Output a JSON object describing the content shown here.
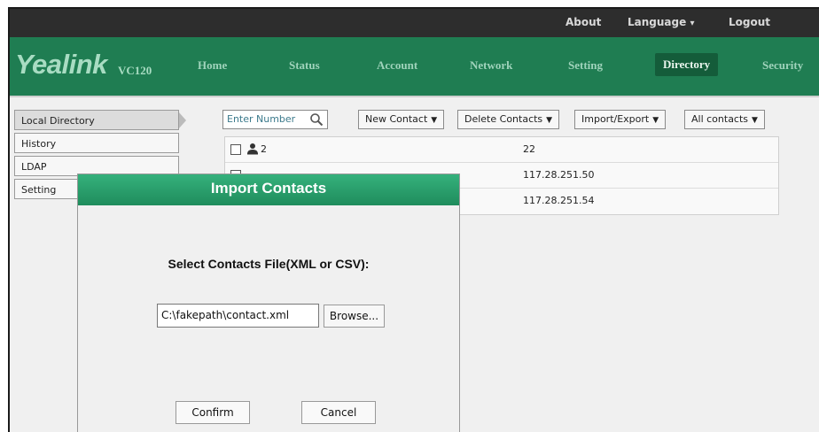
{
  "topbar": {
    "about": "About",
    "language": "Language",
    "language_caret": "▾",
    "logout": "Logout"
  },
  "brand": {
    "logo": "Yealink",
    "model": "VC120"
  },
  "nav": {
    "items": [
      "Home",
      "Status",
      "Account",
      "Network",
      "Setting",
      "Directory",
      "Security"
    ],
    "active": "Directory"
  },
  "sidebar": {
    "items": [
      "Local Directory",
      "History",
      "LDAP",
      "Setting"
    ],
    "active": "Local Directory"
  },
  "toolbar": {
    "search_placeholder": "Enter Number",
    "new_contact": "New Contact",
    "delete_contacts": "Delete Contacts",
    "import_export": "Import/Export",
    "all_contacts": "All contacts",
    "caret": "▼"
  },
  "contacts": [
    {
      "name": "2",
      "number": "22"
    },
    {
      "name": "",
      "number": "117.28.251.50"
    },
    {
      "name": "",
      "number": "117.28.251.54"
    }
  ],
  "dialog": {
    "title": "Import Contacts",
    "label": "Select Contacts File(XML or CSV):",
    "file_value": "C:\\fakepath\\contact.xml",
    "browse": "Browse...",
    "confirm": "Confirm",
    "cancel": "Cancel"
  },
  "colors": {
    "nav_bg": "#1f7d52",
    "dialog_header": "#2aa06c",
    "topbar_bg": "#2d2d2d"
  }
}
